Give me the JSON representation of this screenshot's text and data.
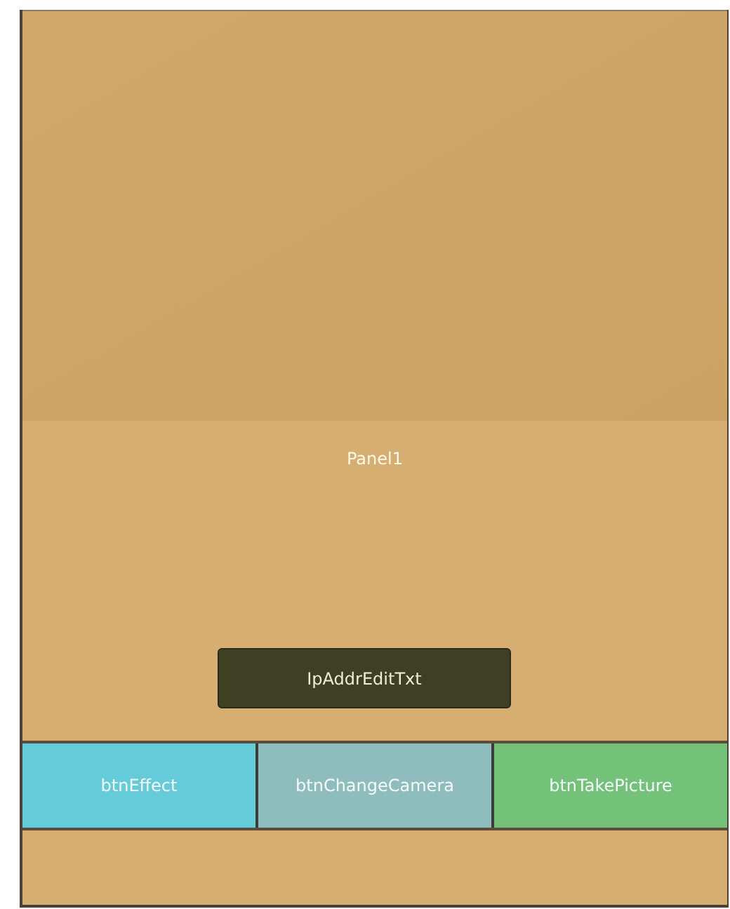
{
  "panel": {
    "label": "Panel1"
  },
  "ip_field": {
    "label": "IpAddrEditTxt"
  },
  "buttons": [
    {
      "label": "btnEffect",
      "color": "#66cbd9"
    },
    {
      "label": "btnChangeCamera",
      "color": "#8fbdbd"
    },
    {
      "label": "btnTakePicture",
      "color": "#74c17a"
    }
  ]
}
